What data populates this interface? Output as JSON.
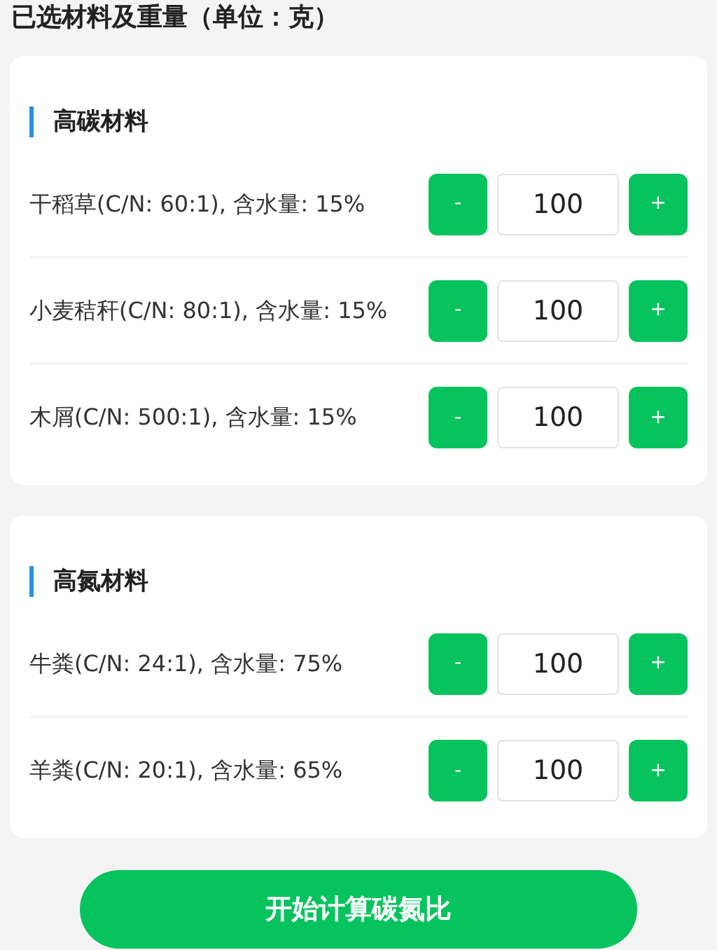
{
  "title": "已选材料及重量（单位：克）",
  "sections": [
    {
      "heading": "高碳材料",
      "items": [
        {
          "label": "干稻草(C/N: 60:1), 含水量: 15%",
          "minus": "-",
          "value": "100",
          "plus": "+"
        },
        {
          "label": "小麦秸秆(C/N: 80:1), 含水量: 15%",
          "minus": "-",
          "value": "100",
          "plus": "+"
        },
        {
          "label": "木屑(C/N: 500:1), 含水量: 15%",
          "minus": "-",
          "value": "100",
          "plus": "+"
        }
      ]
    },
    {
      "heading": "高氮材料",
      "items": [
        {
          "label": "牛粪(C/N: 24:1), 含水量: 75%",
          "minus": "-",
          "value": "100",
          "plus": "+"
        },
        {
          "label": "羊粪(C/N: 20:1), 含水量: 65%",
          "minus": "-",
          "value": "100",
          "plus": "+"
        }
      ]
    }
  ],
  "button": "开始计算碳氮比"
}
